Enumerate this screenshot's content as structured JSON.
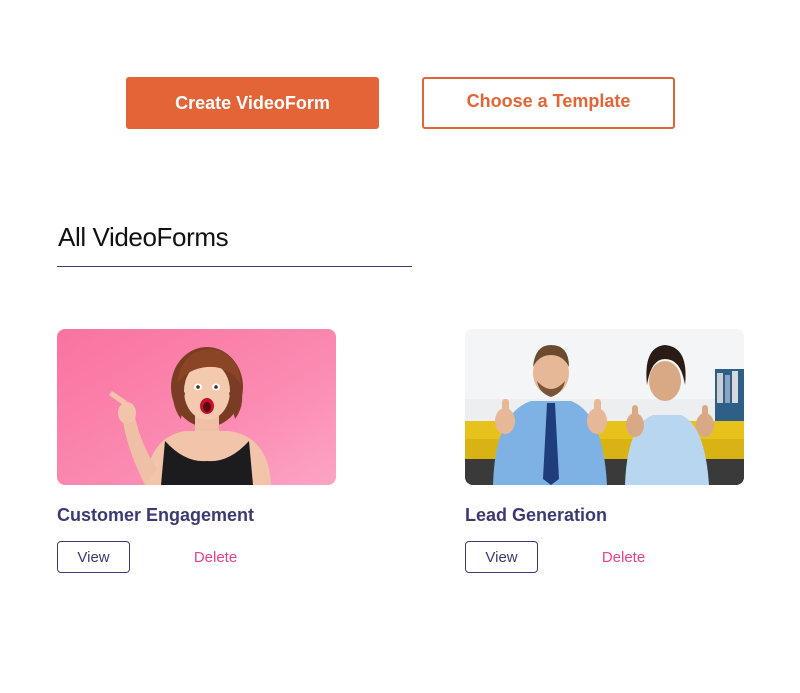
{
  "actions": {
    "create_label": "Create VideoForm",
    "template_label": "Choose a Template"
  },
  "section": {
    "title": "All VideoForms"
  },
  "cards": [
    {
      "title": "Customer Engagement",
      "view_label": "View",
      "delete_label": "Delete"
    },
    {
      "title": "Lead Generation",
      "view_label": "View",
      "delete_label": "Delete"
    }
  ],
  "colors": {
    "primary": "#e36436",
    "navy": "#3c3a74",
    "delete": "#e8418c"
  }
}
